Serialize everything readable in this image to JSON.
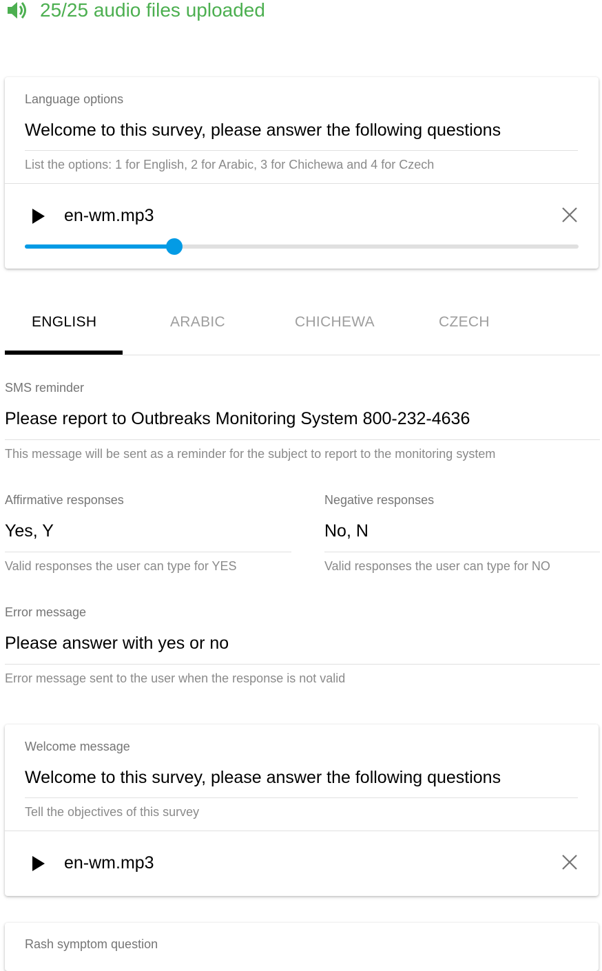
{
  "upload_status": "25/25 audio files uploaded",
  "language_card": {
    "label": "Language options",
    "value": "Welcome to this survey, please answer the following questions",
    "hint": "List the options: 1 for English, 2 for Arabic, 3 for Chichewa and 4 for Czech",
    "audio": {
      "file": "en-wm.mp3",
      "progress": 0.27
    }
  },
  "tabs": [
    "ENGLISH",
    "ARABIC",
    "CHICHEWA",
    "CZECH"
  ],
  "active_tab": "ENGLISH",
  "sms_reminder": {
    "label": "SMS reminder",
    "value": "Please report to Outbreaks Monitoring System 800-232-4636",
    "hint": "This message will be sent as a reminder for the subject to report to the monitoring system"
  },
  "affirmative": {
    "label": "Affirmative responses",
    "value": "Yes, Y",
    "hint": "Valid responses the user can type for YES"
  },
  "negative": {
    "label": "Negative responses",
    "value": "No, N",
    "hint": "Valid responses the user can type for NO"
  },
  "error_message": {
    "label": "Error message",
    "value": "Please answer with yes or no",
    "hint": "Error message sent to the user when the response is not valid"
  },
  "welcome_card": {
    "label": "Welcome message",
    "value": "Welcome to this survey, please answer the following questions",
    "hint": "Tell the objectives of this survey",
    "audio": {
      "file": "en-wm.mp3"
    }
  },
  "rash_card": {
    "label": "Rash symptom question"
  },
  "colors": {
    "status_green": "#4caf50",
    "slider_blue": "#039be5",
    "tab_active": "#000000"
  },
  "icons": {
    "status": "volume-icon",
    "play": "play-icon",
    "remove": "close-icon"
  }
}
